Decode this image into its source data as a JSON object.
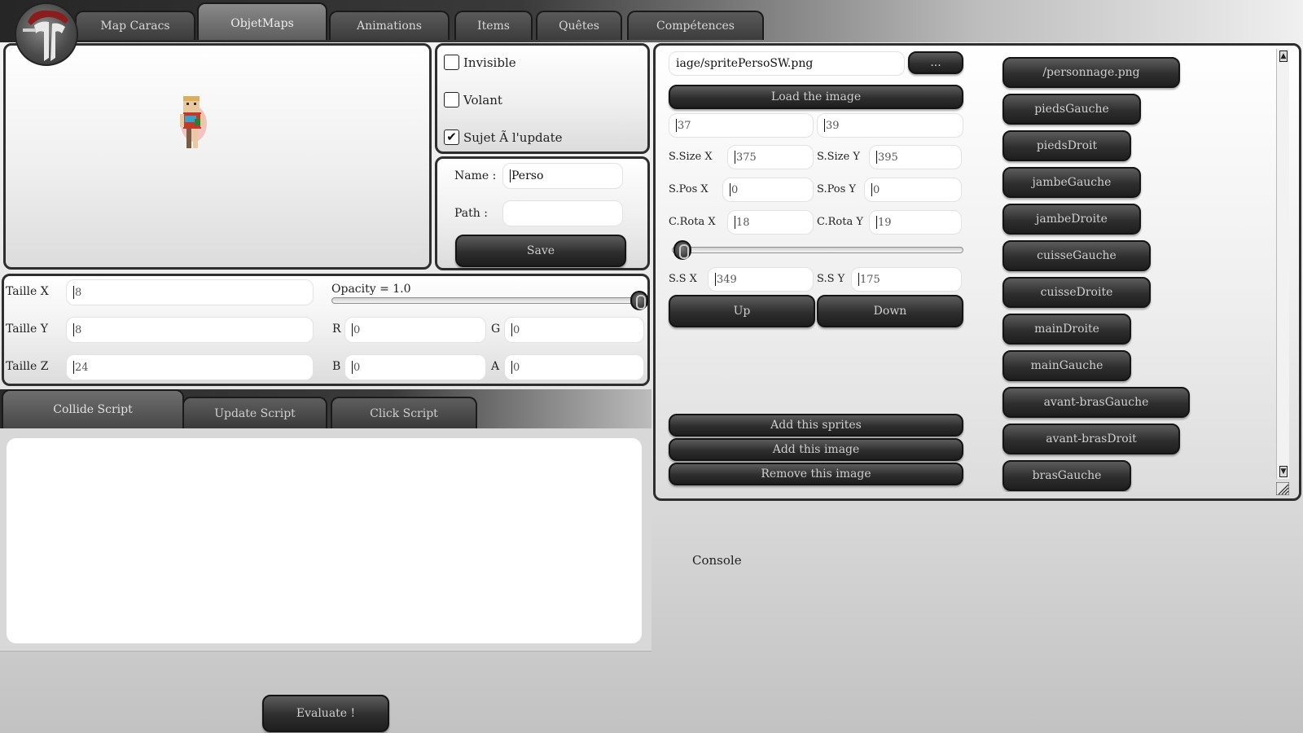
{
  "tabs": [
    {
      "label": "Map Caracs"
    },
    {
      "label": "ObjetMaps"
    },
    {
      "label": "Animations"
    },
    {
      "label": "Items"
    },
    {
      "label": "Quêtes"
    },
    {
      "label": "Compétences"
    }
  ],
  "flags": {
    "invisible": {
      "label": "Invisible",
      "checked": false
    },
    "volant": {
      "label": "Volant",
      "checked": false
    },
    "sujet_update": {
      "label": "Sujet Ã  l'update",
      "checked": true
    }
  },
  "object": {
    "name_label": "Name :",
    "name_value": "Perso",
    "path_label": "Path :",
    "path_value": "",
    "save_label": "Save"
  },
  "transform": {
    "taille_x_label": "Taille X",
    "taille_x": "8",
    "taille_y_label": "Taille Y",
    "taille_y": "8",
    "taille_z_label": "Taille Z",
    "taille_z": "24",
    "opacity_label": "Opacity = 1.0",
    "opacity_value": 1.0,
    "r_label": "R",
    "r": "0",
    "g_label": "G",
    "g": "0",
    "b_label": "B",
    "b": "0",
    "a_label": "A",
    "a": "0"
  },
  "script_tabs": [
    {
      "label": "Collide Script"
    },
    {
      "label": "Update Script"
    },
    {
      "label": "Click Script"
    }
  ],
  "script_text": "",
  "evaluate_label": "Evaluate !",
  "sprite": {
    "image_path": "iage/spritePersoSW.png",
    "browse_label": "...",
    "load_label": "Load the image",
    "field1": "37",
    "field2": "39",
    "ssize_x_label": "S.Size X",
    "ssize_x": "375",
    "ssize_y_label": "S.Size Y",
    "ssize_y": "395",
    "spos_x_label": "S.Pos X",
    "spos_x": "0",
    "spos_y_label": "S.Pos Y",
    "spos_y": "0",
    "crota_x_label": "C.Rota X",
    "crota_x": "18",
    "crota_y_label": "C.Rota Y",
    "crota_y": "19",
    "rotation_slider_value": 0,
    "ss_x_label": "S.S X",
    "ss_x": "349",
    "ss_y_label": "S.S Y",
    "ss_y": "175",
    "up_label": "Up",
    "down_label": "Down",
    "add_sprites_label": "Add this sprites",
    "add_image_label": "Add this image",
    "remove_image_label": "Remove this image"
  },
  "parts": [
    {
      "label": "/personnage.png"
    },
    {
      "label": "piedsGauche"
    },
    {
      "label": "piedsDroit"
    },
    {
      "label": "jambeGauche"
    },
    {
      "label": "jambeDroite"
    },
    {
      "label": "cuisseGauche"
    },
    {
      "label": "cuisseDroite"
    },
    {
      "label": "mainDroite"
    },
    {
      "label": "mainGauche"
    },
    {
      "label": "avant-brasGauche"
    },
    {
      "label": "avant-brasDroit"
    },
    {
      "label": "brasGauche"
    }
  ],
  "console_label": "Console",
  "icons": {
    "logo": "character-logo",
    "scroll_up": "scroll-up-arrow-icon",
    "scroll_down": "scroll-down-arrow-icon",
    "resize": "resize-grip-icon"
  },
  "colors": {
    "button_dark": "#2e2e2e",
    "button_text": "#cfcfcf",
    "topbar_dark": "#262626",
    "panel_border": "#2e2e2e"
  }
}
